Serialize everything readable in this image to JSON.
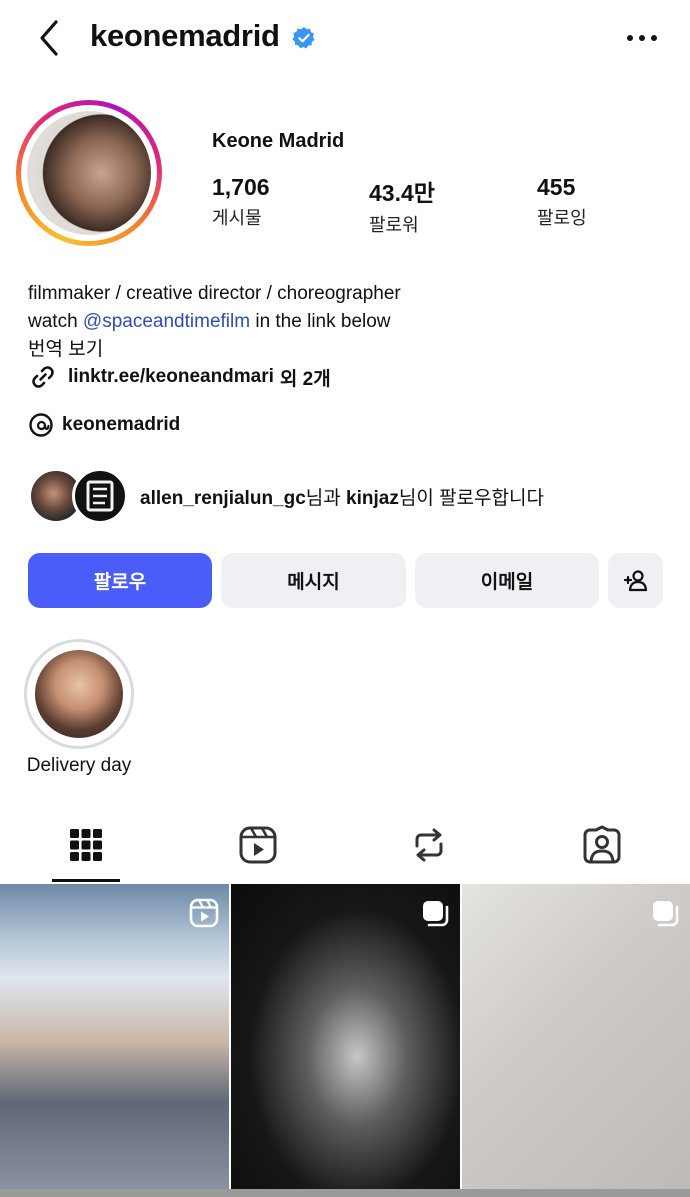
{
  "header": {
    "username": "keonemadrid"
  },
  "profile": {
    "full_name": "Keone Madrid",
    "stats": [
      {
        "value": "1,706",
        "label": "게시물"
      },
      {
        "value": "43.4만",
        "label": "팔로워"
      },
      {
        "value": "455",
        "label": "팔로잉"
      }
    ],
    "bio_line1": "filmmaker / creative director / choreographer",
    "bio_line2_prefix": "watch ",
    "bio_mention": "@spaceandtimefilm",
    "bio_line2_suffix": " in the link below",
    "translate_label": "번역 보기",
    "link_text": "linktr.ee/keoneandmari",
    "link_extra": "외 2개",
    "threads_handle": "keonemadrid"
  },
  "mutuals": {
    "user1": "allen_renjialun_gc",
    "mid": "님과 ",
    "user2": "kinjaz",
    "suffix": "님이 팔로우합니다"
  },
  "actions": {
    "follow": "팔로우",
    "message": "메시지",
    "email": "이메일"
  },
  "highlights": [
    {
      "label": "Delivery day"
    }
  ],
  "colors": {
    "follow_button": "#4a5df9",
    "verified_badge": "#3797f0",
    "mention": "#2f4ea8"
  }
}
